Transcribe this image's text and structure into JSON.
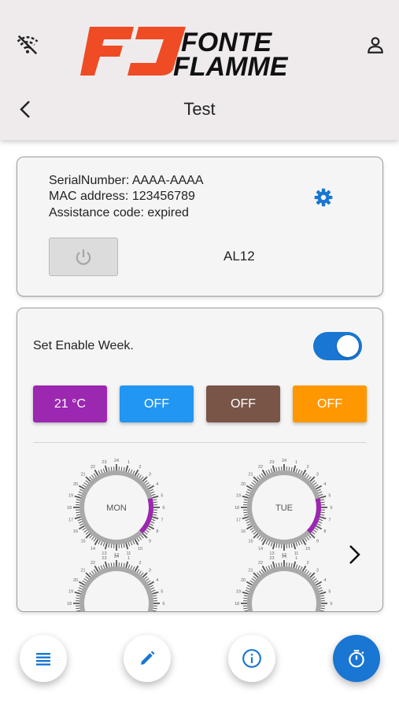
{
  "header": {
    "title": "Test",
    "logo_text_top": "FONTE",
    "logo_text_bottom": "FLAMME",
    "icons": {
      "left": "wifi-off-icon",
      "right": "user-icon",
      "back": "chevron-left-icon"
    }
  },
  "device": {
    "serial_line": "SerialNumber: AAAA-AAAA",
    "mac_line": "MAC address: 123456789",
    "assistance_line": "Assistance code: expired",
    "model": "AL12",
    "settings_icon": "gear-icon",
    "power_icon": "power-icon"
  },
  "week": {
    "label": "Set Enable Week.",
    "enabled": true,
    "temp_buttons": [
      {
        "label": "21 °C",
        "color": "#9c27b0"
      },
      {
        "label": "OFF",
        "color": "#2196f3"
      },
      {
        "label": "OFF",
        "color": "#795548"
      },
      {
        "label": "OFF",
        "color": "#ff9800"
      }
    ],
    "days": [
      {
        "label": "MON",
        "active_from_hour": 5,
        "active_to_hour": 9
      },
      {
        "label": "TUE",
        "active_from_hour": 5,
        "active_to_hour": 9
      }
    ],
    "next_icon": "chevron-right-icon"
  },
  "bottom_nav": [
    {
      "icon": "list-icon",
      "active": false
    },
    {
      "icon": "pencil-icon",
      "active": false
    },
    {
      "icon": "info-icon",
      "active": false
    },
    {
      "icon": "timer-icon",
      "active": true
    }
  ],
  "colors": {
    "accent": "#1976d2",
    "schedule": "#9c27b0"
  }
}
